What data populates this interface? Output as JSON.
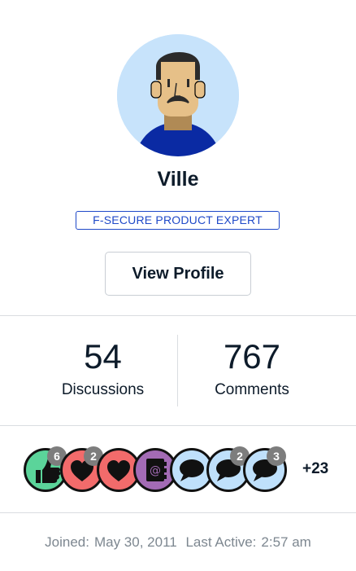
{
  "user": {
    "name": "Ville",
    "role": "F-SECURE PRODUCT EXPERT",
    "view_profile_label": "View Profile"
  },
  "stats": [
    {
      "value": "54",
      "label": "Discussions"
    },
    {
      "value": "767",
      "label": "Comments"
    }
  ],
  "badges": [
    {
      "icon": "thumbs-up-icon",
      "bg": "#5bd49a",
      "count": "6"
    },
    {
      "icon": "heart-icon",
      "bg": "#f26b6b",
      "count": "2"
    },
    {
      "icon": "heart-icon",
      "bg": "#f26b6b",
      "count": ""
    },
    {
      "icon": "address-book-icon",
      "bg": "#a36bb5",
      "count": ""
    },
    {
      "icon": "speech-bubble-icon",
      "bg": "#bfe0fb",
      "count": ""
    },
    {
      "icon": "speech-bubble-icon",
      "bg": "#bfe0fb",
      "count": "2"
    },
    {
      "icon": "speech-bubble-icon",
      "bg": "#bfe0fb",
      "count": "3"
    }
  ],
  "more_badges": "+23",
  "meta": {
    "joined_label": "Joined:",
    "joined_value": "May 30, 2011",
    "last_active_label": "Last Active:",
    "last_active_value": "2:57 am"
  },
  "colors": {
    "accent": "#1f49c8",
    "text": "#0d1b2a",
    "muted": "#7d8790",
    "divider": "#dadde1"
  }
}
